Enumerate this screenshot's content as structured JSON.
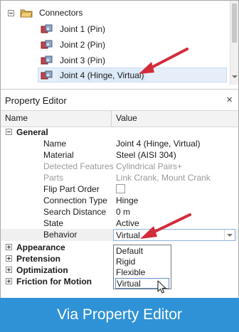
{
  "tree": {
    "folder": {
      "label": "Connectors",
      "icon": "folder-icon"
    },
    "items": [
      {
        "label": "Joint 1 (Pin)",
        "icon": "joint-icon"
      },
      {
        "label": "Joint 2 (Pin)",
        "icon": "joint-icon"
      },
      {
        "label": "Joint 3 (Pin)",
        "icon": "joint-icon"
      },
      {
        "label": "Joint 4 (Hinge, Virtual)",
        "icon": "joint-icon",
        "selected": true
      }
    ]
  },
  "property_editor": {
    "title": "Property Editor",
    "close_glyph": "×",
    "columns": {
      "name": "Name",
      "value": "Value"
    },
    "general_group": "General",
    "properties": {
      "name": {
        "label": "Name",
        "value": "Joint 4 (Hinge, Virtual)"
      },
      "material": {
        "label": "Material",
        "value": "Steel (AISI 304)"
      },
      "detected": {
        "label": "Detected Features",
        "value": "Cylindrical Pairs+"
      },
      "parts": {
        "label": "Parts",
        "value": "Link Crank, Mount Crank"
      },
      "flip": {
        "label": "Flip Part Order",
        "checked": false
      },
      "connection": {
        "label": "Connection Type",
        "value": "Hinge"
      },
      "search": {
        "label": "Search Distance",
        "value": "0 m"
      },
      "state": {
        "label": "State",
        "value": "Active"
      },
      "behavior": {
        "label": "Behavior",
        "value": "Virtual"
      }
    },
    "behavior_options": [
      "Default",
      "Rigid",
      "Flexible",
      "Virtual"
    ],
    "highlighted_option": "Virtual",
    "collapsed_groups": [
      "Appearance",
      "Pretension",
      "Optimization",
      "Friction for Motion"
    ]
  },
  "caption": "Via Property Editor",
  "colors": {
    "caption_bg": "#2f92d6",
    "arrow": "#d42b3a",
    "selection": "#ddeaf7"
  }
}
